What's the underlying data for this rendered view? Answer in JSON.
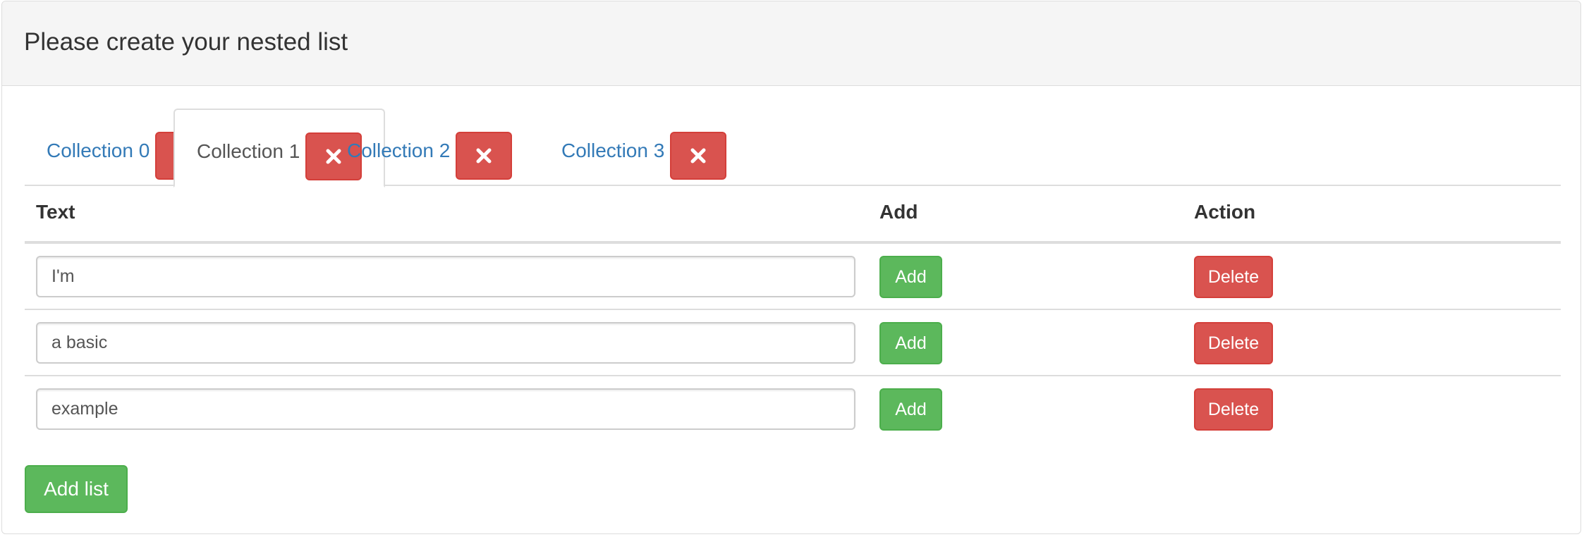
{
  "panel": {
    "title": "Please create your nested list"
  },
  "tabs": [
    {
      "label": "Collection 0",
      "active": false
    },
    {
      "label": "Collection 1",
      "active": true
    },
    {
      "label": "Collection 2",
      "active": false
    },
    {
      "label": "Collection 3",
      "active": false
    }
  ],
  "table": {
    "headers": {
      "text": "Text",
      "add": "Add",
      "action": "Action"
    },
    "rows": [
      {
        "text": "I'm",
        "add_label": "Add",
        "delete_label": "Delete"
      },
      {
        "text": "a basic",
        "add_label": "Add",
        "delete_label": "Delete"
      },
      {
        "text": "example",
        "add_label": "Add",
        "delete_label": "Delete"
      }
    ]
  },
  "footer": {
    "add_list_label": "Add list"
  },
  "icons": {
    "tab_close": "close-icon"
  },
  "colors": {
    "link": "#337ab7",
    "danger": "#d9534f",
    "success": "#5cb85c",
    "heading_bg": "#f5f5f5"
  }
}
